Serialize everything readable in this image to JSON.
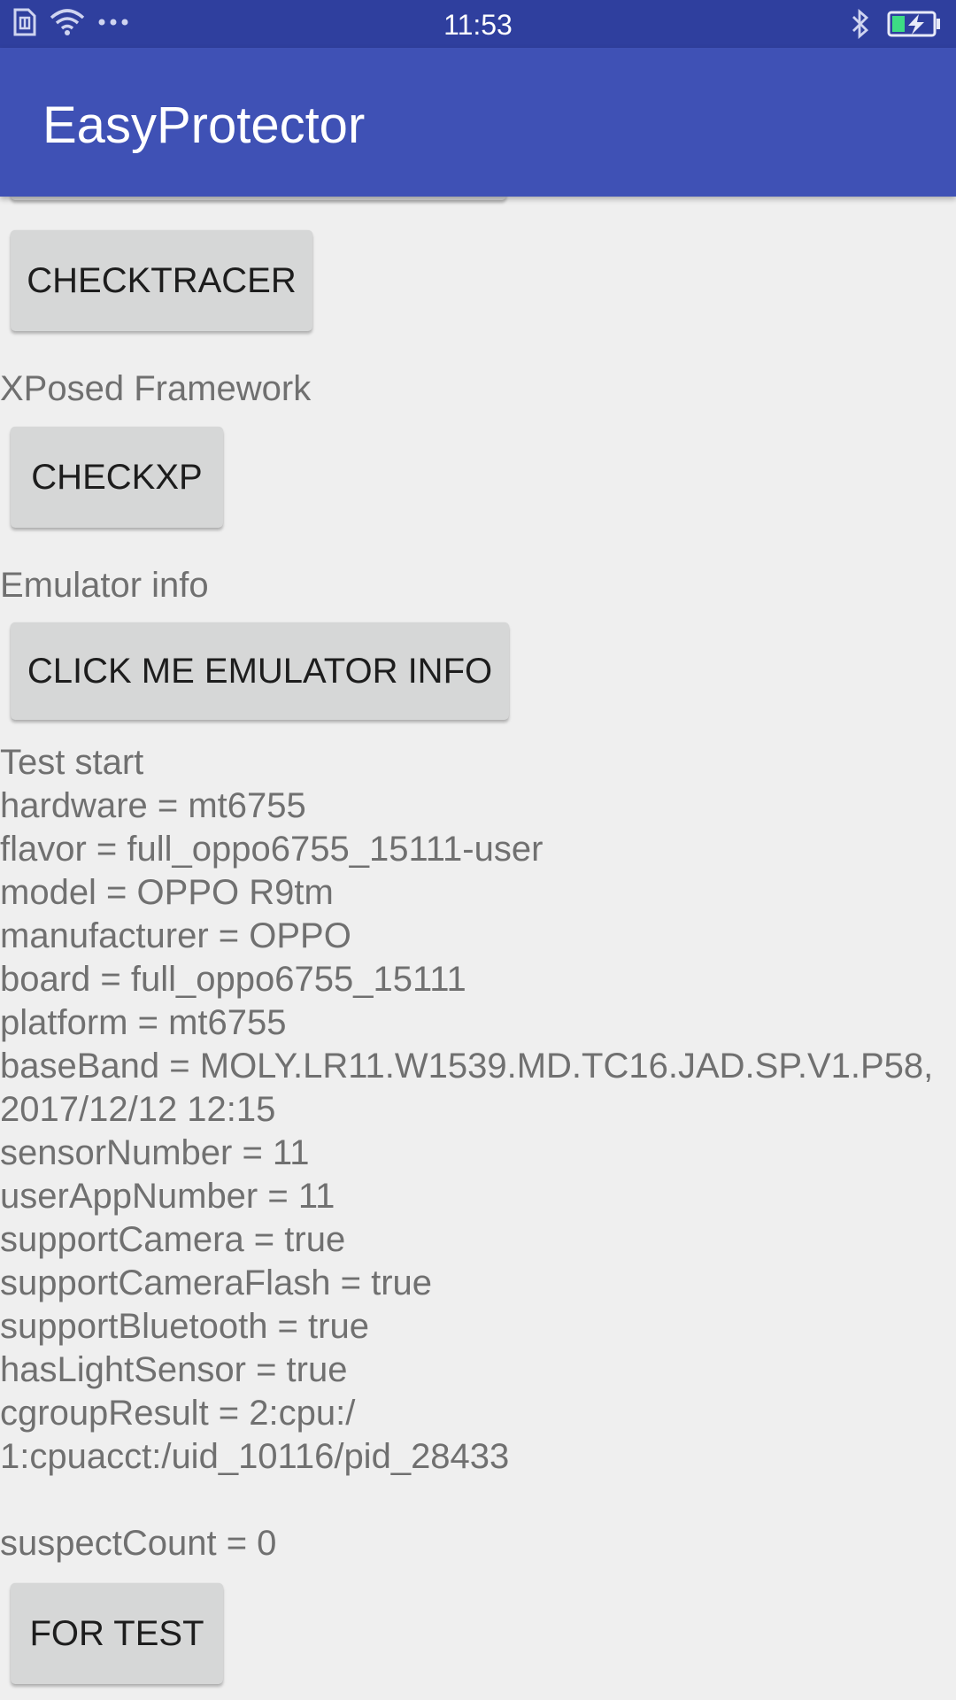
{
  "status_bar": {
    "time": "11:53",
    "icons": [
      "sim-icon",
      "wifi-icon",
      "more-dots-icon",
      "bluetooth-icon",
      "battery-charging-icon"
    ]
  },
  "app_bar": {
    "title": "EasyProtector"
  },
  "sections": {
    "check_tracer_button": "CHECKTRACER",
    "xposed_label": "XPosed Framework",
    "check_xp_button": "CHECKXP",
    "emulator_label": "Emulator info",
    "emulator_button": "CLICK ME EMULATOR INFO",
    "for_test_button": "FOR TEST"
  },
  "log": {
    "test_start": "Test start",
    "hardware": "hardware = mt6755",
    "flavor": "flavor = full_oppo6755_15111-user",
    "model": "model = OPPO R9tm",
    "manufacturer": "manufacturer = OPPO",
    "board": "board = full_oppo6755_15111",
    "platform": "platform = mt6755",
    "baseband_1": "baseBand = MOLY.LR11.W1539.MD.TC16.JAD.SP.V1.P58,",
    "baseband_2": "2017/12/12 12:15",
    "sensor_number": "sensorNumber = 11",
    "user_app_number": "userAppNumber = 11",
    "support_camera": "supportCamera = true",
    "support_camera_flash": "supportCameraFlash = true",
    "support_bluetooth": "supportBluetooth = true",
    "has_light_sensor": "hasLightSensor = true",
    "cgroup_1": "cgroupResult = 2:cpu:/",
    "cgroup_2": "1:cpuacct:/uid_10116/pid_28433",
    "suspect_count": "suspectCount = 0"
  }
}
